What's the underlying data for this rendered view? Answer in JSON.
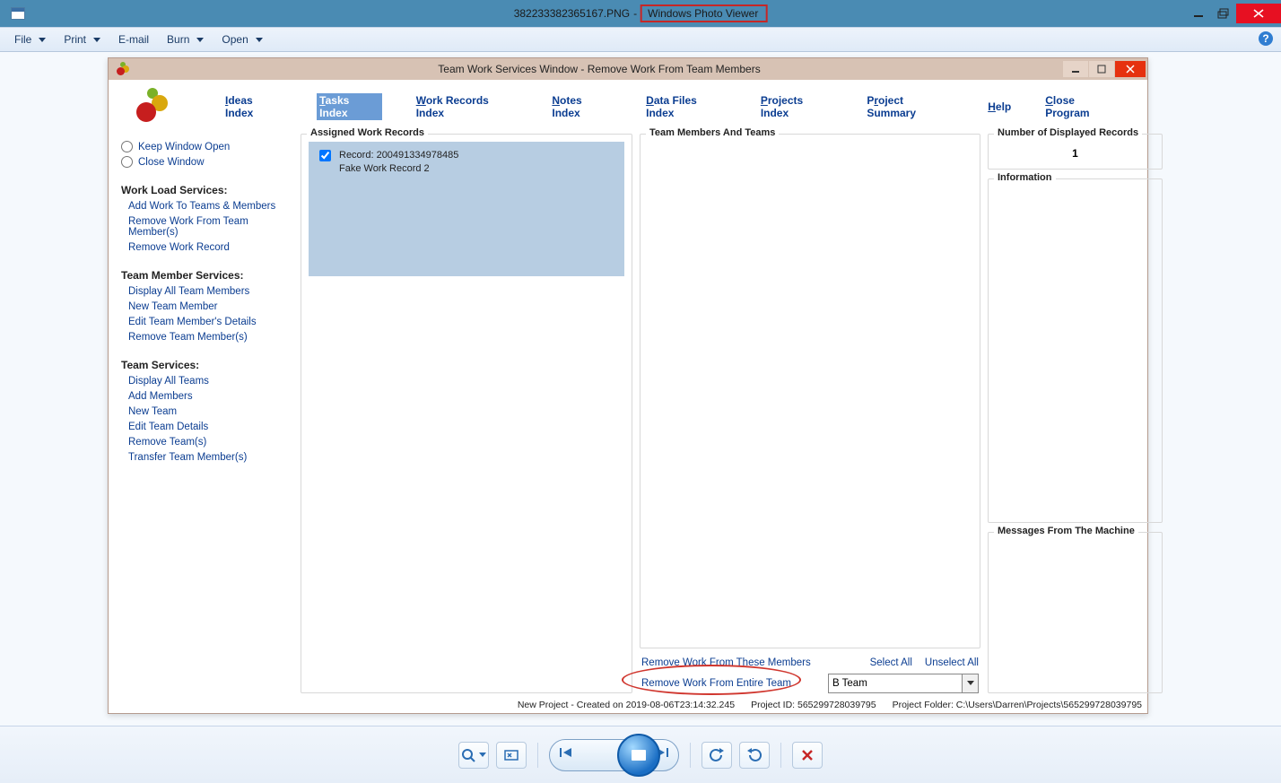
{
  "photo_viewer": {
    "filename": "382233382365167.PNG",
    "separator": "-",
    "app_name": "Windows Photo Viewer",
    "menus": {
      "file": "File",
      "print": "Print",
      "email": "E-mail",
      "burn": "Burn",
      "open": "Open"
    }
  },
  "app": {
    "title": "Team Work Services Window - Remove Work From Team Members",
    "tabs": {
      "ideas": "Ideas Index",
      "tasks": "Tasks Index",
      "work_records": "Work Records Index",
      "notes": "Notes Index",
      "data_files": "Data Files Index",
      "projects": "Projects Index",
      "summary": "Project Summary",
      "help": "Help",
      "close": "Close Program"
    },
    "sidebar": {
      "keep_open": "Keep Window Open",
      "close_window": "Close Window",
      "sections": {
        "workload_heading": "Work Load Services:",
        "workload_links": {
          "add_work": "Add Work To Teams & Members",
          "remove_work_members": "Remove Work From Team Member(s)",
          "remove_work_record": "Remove Work Record"
        },
        "member_heading": "Team Member Services:",
        "member_links": {
          "display_members": "Display All Team Members",
          "new_member": "New Team Member",
          "edit_member": "Edit Team Member's Details",
          "remove_member": "Remove Team Member(s)"
        },
        "team_heading": "Team Services:",
        "team_links": {
          "display_teams": "Display All Teams",
          "add_members": "Add Members",
          "new_team": "New Team",
          "edit_team": "Edit Team Details",
          "remove_team": "Remove Team(s)",
          "transfer": "Transfer Team Member(s)"
        }
      }
    },
    "assigned": {
      "legend": "Assigned Work Records",
      "record_line1": "Record: 200491334978485",
      "record_line2": "Fake Work Record 2"
    },
    "teams_box": {
      "legend": "Team Members And Teams",
      "remove_from_members": "Remove Work From These Members",
      "select_all": "Select All",
      "unselect_all": "Unselect All",
      "remove_entire_team": "Remove Work From Entire Team",
      "team_selected": "B Team"
    },
    "right": {
      "count_legend": "Number of Displayed Records",
      "count_value": "1",
      "info_legend": "Information",
      "messages_legend": "Messages From The Machine"
    },
    "status": {
      "left": "New Project - Created on 2019-08-06T23:14:32.245",
      "mid": "Project ID:  565299728039795",
      "right": "Project Folder:  C:\\Users\\Darren\\Projects\\565299728039795"
    }
  }
}
